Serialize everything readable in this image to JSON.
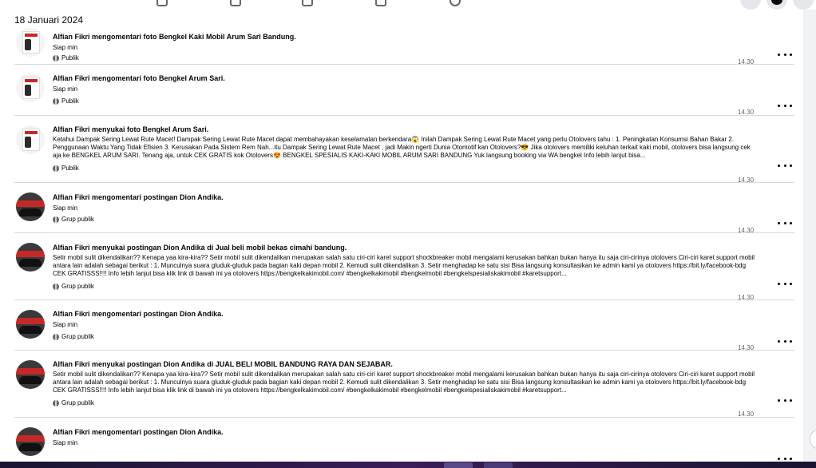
{
  "date_header": "18 Januari 2024",
  "activities": [
    {
      "title": "Alfian Fikri mengomentari foto Bengkel Kaki Mobil Arum Sari Bandung.",
      "excerpt": "",
      "subtext": "Siap min",
      "audience": "Publik",
      "time": "14.30",
      "avatar": "bengkel"
    },
    {
      "title": "Alfian Fikri mengomentari foto Bengkel Arum Sari.",
      "excerpt": "",
      "subtext": "Siap min",
      "audience": "Publik",
      "time": "14.30",
      "avatar": "bengkel"
    },
    {
      "title": "Alfian Fikri menyukai foto Bengkel Arum Sari.",
      "excerpt": "Ketahui Dampak Sering Lewat Rute Macet! Dampak Sering Lewat Rute Macet dapat membahayakan keselamatan berkendara😱 Inilah Dampak Sering Lewat Rute Macet yang perlu Otolovers tahu : 1. Peningkatan Konsumsi Bahan Bakar 2. Penggunaan Waktu Yang Tidak Efisien 3. Kerusakan Pada Sistem Rem Nah...itu Dampak Sering Lewat Rute Macet , jadi Makin ngerti Dunia Otomotif kan Otolovers?😎 Jika otolovers memiliki keluhan terkait kaki mobil, otolovers bisa langsung cek aja ke BENGKEL ARUM SARI. Tenang aja, untuk CEK GRATIS kok Otolovers😍 BENGKEL SPESIALIS KAKI-KAKI MOBIL ARUM SARI BANDUNG Yuk langsung booking via WA bengkel Info lebih lanjut bisa...",
      "subtext": "",
      "audience": "Publik",
      "time": "14.30",
      "avatar": "bengkel"
    },
    {
      "title": "Alfian Fikri mengomentari postingan Dion Andika.",
      "excerpt": "",
      "subtext": "Siap min",
      "audience": "Grup publik",
      "time": "14.30",
      "avatar": "dion"
    },
    {
      "title": "Alfian Fikri menyukai postingan Dion Andika di Jual beli mobil bekas cimahi bandung.",
      "excerpt": "Setir mobil sulit dikendalikan?? Kenapa yaa kira-kira?? Setir mobil sulit dikendalikan merupakan salah satu ciri-ciri karet support shockbreaker mobil mengalami kerusakan bahkan bukan hanya itu saja ciri-cirinya otolovers Ciri-ciri karet support mobil antara lain adalah sebagai berikut : 1. Munculnya suara gluduk-gluduk pada bagian kaki depan mobil 2. Kemudi sulit dikendalikan 3. Setir menghadap ke satu sisi Bisa langsung konsultasikan ke admin kami ya otolovers https://bit.ly/facebook-bdg CEK GRATISSS!!!! Info lebih lanjut bisa klik link di bawah ini ya otolovers https://bengkelkakimobil.com/ #bengkelkakimobil #bengkelmobil #bengkelspesialiskakimobil #karetsupport...",
      "subtext": "",
      "audience": "Grup publik",
      "time": "14.30",
      "avatar": "dion"
    },
    {
      "title": "Alfian Fikri mengomentari postingan Dion Andika.",
      "excerpt": "",
      "subtext": "Siap min",
      "audience": "Grup publik",
      "time": "14.30",
      "avatar": "dion"
    },
    {
      "title": "Alfian Fikri menyukai postingan Dion Andika di JUAL BELI MOBIL BANDUNG RAYA DAN SEJABAR.",
      "excerpt": "Setir mobil sulit dikendalikan?? Kenapa yaa kira-kira?? Setir mobil sulit dikendalikan merupakan salah satu ciri-ciri karet support shockbreaker mobil mengalami kerusakan bahkan bukan hanya itu saja ciri-cirinya otolovers Ciri-ciri karet support mobil antara lain adalah sebagai berikut : 1. Munculnya suara gluduk-gluduk pada bagian kaki depan mobil 2. Kemudi sulit dikendalikan 3. Setir menghadap ke satu sisi Bisa langsung konsultasikan ke admin kami ya otolovers https://bit.ly/facebook-bdg CEK GRATISSS!!!! Info lebih lanjut bisa klik link di bawah ini ya otolovers https://bengkelkakimobil.com/ #bengkelkakimobil #bengkelmobil #bengkelspesialiskakimobil #karetsupport...",
      "subtext": "",
      "audience": "Grup publik",
      "time": "14.30",
      "avatar": "dion"
    },
    {
      "title": "Alfian Fikri mengomentari postingan Dion Andika.",
      "excerpt": "",
      "subtext": "Siap min",
      "audience": "",
      "time": "",
      "avatar": "dion"
    }
  ],
  "icons": {
    "more": "more-options-icon",
    "audience": "globe-icon"
  },
  "colors": {
    "background": "#f0f2f5",
    "panel": "#ffffff",
    "secondary_text": "#65676b",
    "divider": "#d6d9dd"
  }
}
